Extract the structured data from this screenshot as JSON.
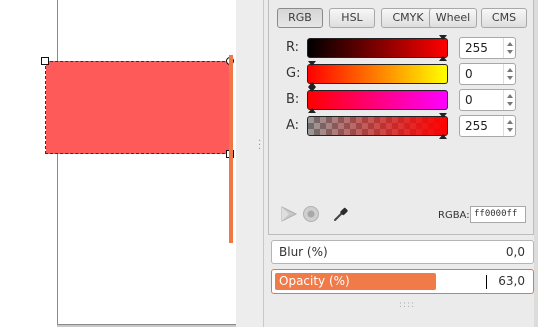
{
  "color_modes": {
    "tabs": [
      {
        "label": "RGB",
        "active": true
      },
      {
        "label": "HSL",
        "active": false
      },
      {
        "label": "CMYK",
        "active": false
      },
      {
        "label": "Wheel",
        "active": false
      },
      {
        "label": "CMS",
        "active": false
      }
    ]
  },
  "channels": [
    {
      "label": "R:",
      "value": "255",
      "fraction": 1.0
    },
    {
      "label": "G:",
      "value": "0",
      "fraction": 0.0
    },
    {
      "label": "B:",
      "value": "0",
      "fraction": 0.0
    },
    {
      "label": "A:",
      "value": "255",
      "fraction": 1.0
    }
  ],
  "rgba": {
    "label": "RGBA:",
    "value": "ff0000ff"
  },
  "blur": {
    "label": "Blur (%)",
    "value": "0,0"
  },
  "opacity": {
    "label": "Opacity (%)",
    "value": "63,0",
    "fraction": 0.63
  },
  "icons": {
    "cone": "cone-gradient-icon",
    "disc": "disc-gradient-icon",
    "picker": "eyedropper-icon"
  },
  "colors": {
    "object_fill": "#ff5a5a",
    "accent": "#f07a48"
  }
}
